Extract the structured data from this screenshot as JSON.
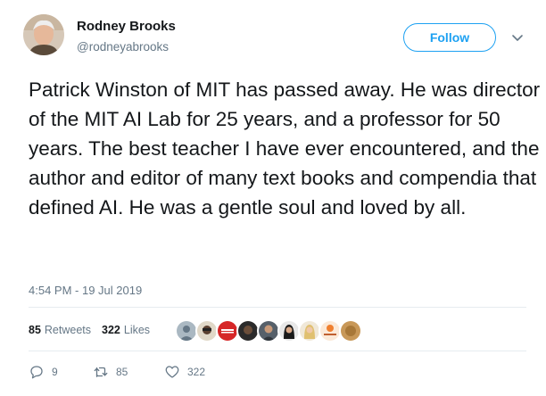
{
  "author": {
    "name": "Rodney Brooks",
    "handle": "@rodneyabrooks"
  },
  "follow_label": "Follow",
  "tweet_text": "Patrick Winston of MIT has passed away. He was director of the MIT AI Lab for 25 years, and a professor for 50 years. The best teacher I have ever encountered, and the author and editor of many text books and compendia that defined AI. He was a gentle soul and loved by all.",
  "timestamp": "4:54 PM - 19 Jul 2019",
  "stats": {
    "retweets_count": "85",
    "retweets_label": "Retweets",
    "likes_count": "322",
    "likes_label": "Likes"
  },
  "actions": {
    "replies": "9",
    "retweets": "85",
    "likes": "322"
  },
  "colors": {
    "accent": "#1da1f2",
    "muted": "#657786",
    "text": "#14171a"
  },
  "icons": [
    "chevron-down-icon",
    "reply-icon",
    "retweet-icon",
    "heart-icon"
  ]
}
